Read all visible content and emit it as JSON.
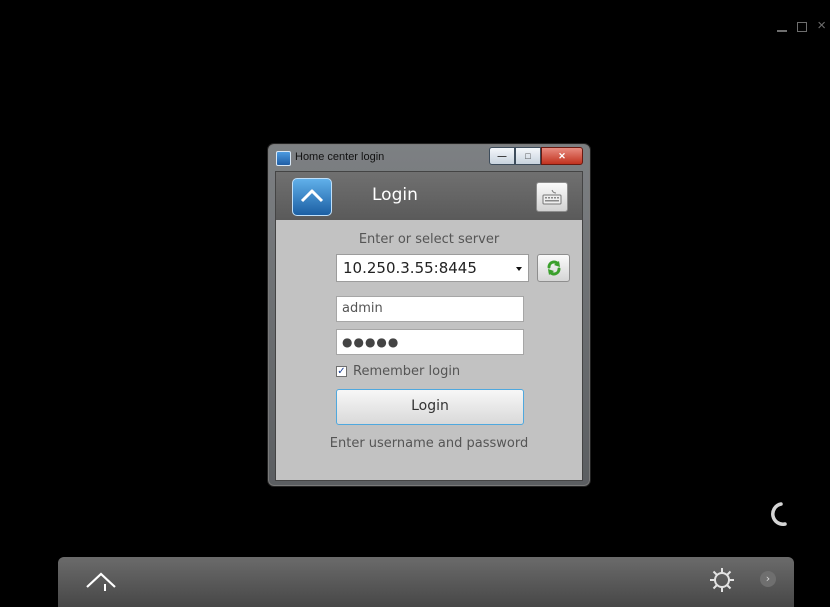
{
  "window_controls": {
    "minimize": "—",
    "maximize": "□",
    "close": "×"
  },
  "dialog": {
    "title": "Home center login",
    "header_title": "Login",
    "server_label": "Enter or select server",
    "server_value": "10.250.3.55:8445",
    "username_value": "admin",
    "password_masked": "●●●●●",
    "remember_label": "Remember login",
    "remember_checked": true,
    "login_button": "Login",
    "hint": "Enter username and password"
  },
  "icons": {
    "home": "home-icon",
    "keyboard": "keyboard-icon",
    "refresh": "refresh-icon",
    "settings": "gear-icon",
    "next": "chevron-right-icon",
    "loading": "loading-icon"
  },
  "colors": {
    "accent_blue": "#4fa8de",
    "dialog_background": "#c2c2c2",
    "header_background": "#666666",
    "bottom_bar": "#595959"
  },
  "bottom_bar": {
    "next_symbol": "›"
  }
}
